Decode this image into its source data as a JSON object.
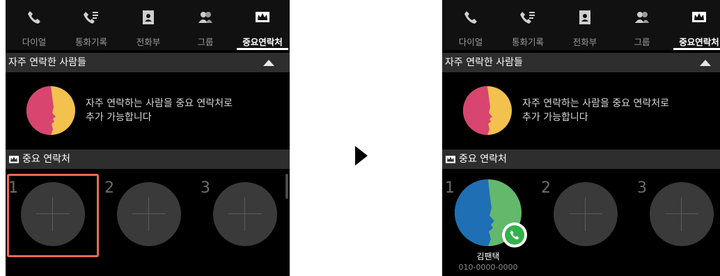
{
  "tabs": [
    {
      "label": "다이얼",
      "icon": "phone-icon"
    },
    {
      "label": "통화기록",
      "icon": "call-log-icon"
    },
    {
      "label": "전화부",
      "icon": "contacts-book-icon"
    },
    {
      "label": "그룹",
      "icon": "group-icon"
    },
    {
      "label": "중요연락처",
      "icon": "crown-icon",
      "active": true
    }
  ],
  "frequent": {
    "title": "자주 연락한 사람들",
    "hint_line1": "자주 연락하는 사람을 중요 연락처로",
    "hint_line2": "추가 가능합니다"
  },
  "favorites": {
    "title": "중요 연락처",
    "slot_numbers": [
      "1",
      "2",
      "3"
    ]
  },
  "added_contact": {
    "name": "김팬택",
    "phone": "010-0000-0000"
  },
  "colors": {
    "highlight": "#f06a4f",
    "call_green": "#31b24a",
    "avatar_yellow": "#f2c14e",
    "avatar_pink": "#d8456e",
    "avatar_blue": "#1f6fb5",
    "avatar_green": "#63b86c"
  }
}
